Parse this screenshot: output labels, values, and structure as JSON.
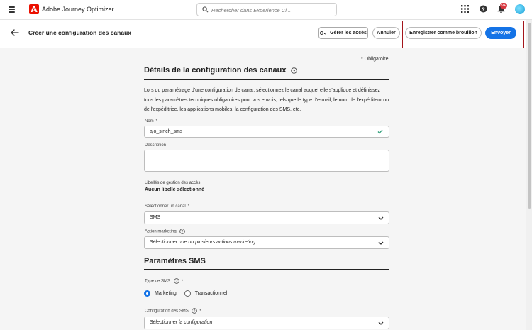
{
  "app": {
    "title": "Adobe Journey Optimizer"
  },
  "search": {
    "placeholder": "Rechercher dans Experience Cl..."
  },
  "notifications": {
    "badge": "9+"
  },
  "header": {
    "title": "Créer une configuration des canaux",
    "access_label": "Gérer les accès",
    "cancel_label": "Annuler",
    "draft_label": "Enregistrer comme brouillon",
    "send_label": "Envoyer"
  },
  "form": {
    "required_note": "* Obligatoire",
    "details_title": "Détails de la configuration des canaux",
    "description": "Lors du paramétrage d'une configuration de canal, sélectionnez le canal auquel elle s'applique et définissez tous les paramètres techniques obligatoires pour vos envois, tels que le type d'e-mail, le nom de l'expéditeur ou de l'expéditrice, les applications mobiles, la configuration des SMS, etc.",
    "name_label": "Nom",
    "name_value": "ajo_sinch_sms",
    "description_label": "Description",
    "description_value": "",
    "access_labels_label": "Libellés de gestion des accès",
    "access_labels_value": "Aucun libellé sélectionné",
    "channel_label": "Sélectionner un canal",
    "channel_value": "SMS",
    "marketing_action_label": "Action marketing",
    "marketing_action_placeholder": "Sélectionner une ou plusieurs actions marketing",
    "required_star": "*"
  },
  "sms": {
    "title": "Paramètres SMS",
    "type_label": "Type de SMS",
    "options": [
      "Marketing",
      "Transactionnel"
    ],
    "selected": "Marketing",
    "config_label": "Configuration des SMS",
    "config_placeholder": "Sélectionner la configuration"
  },
  "colors": {
    "accent": "#1473e6",
    "brand": "#eb1000",
    "highlight": "#a4151b"
  }
}
